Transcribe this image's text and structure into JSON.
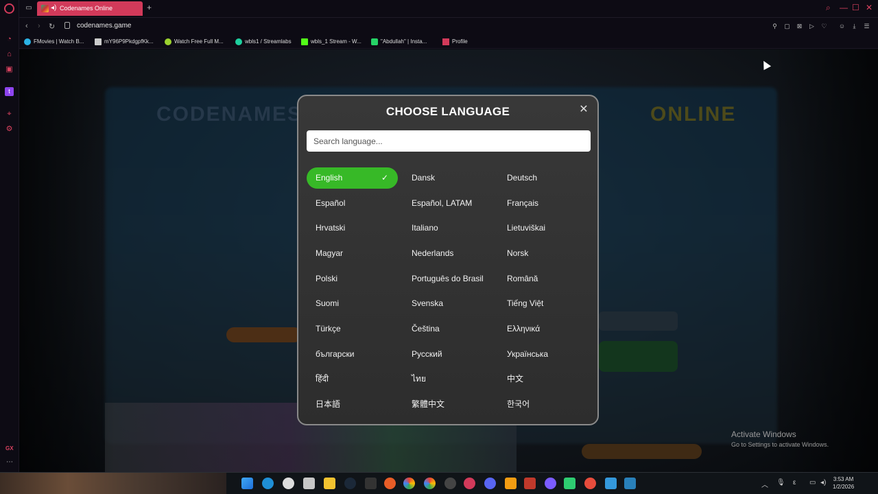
{
  "browser": {
    "tab_title": "Codenames Online",
    "url": "codenames.game",
    "bookmarks": [
      {
        "label": "FMovies | Watch B...",
        "color": "#2bb3e6"
      },
      {
        "label": "mY96P9PkdgpfKk...",
        "color": "#cccccc"
      },
      {
        "label": "Watch Free Full M...",
        "color": "#9bd12e"
      },
      {
        "label": "wbls1 / Streamlabs",
        "color": "#1ecf9e"
      },
      {
        "label": "wbls_1 Stream - W...",
        "color": "#53fc18"
      },
      {
        "label": "\"Abdullah\" | Insta...",
        "color": "#25d366"
      },
      {
        "label": "Profile",
        "color": "#d23a5a"
      }
    ]
  },
  "modal": {
    "title": "CHOOSE LANGUAGE",
    "search_placeholder": "Search language...",
    "selected": "English",
    "languages": [
      [
        "English",
        "Dansk",
        "Deutsch"
      ],
      [
        "Español",
        "Español, LATAM",
        "Français"
      ],
      [
        "Hrvatski",
        "Italiano",
        "Lietuviškai"
      ],
      [
        "Magyar",
        "Nederlands",
        "Norsk"
      ],
      [
        "Polski",
        "Português do Brasil",
        "Română"
      ],
      [
        "Suomi",
        "Svenska",
        "Tiếng Việt"
      ],
      [
        "Türkçe",
        "Čeština",
        "Ελληνικά"
      ],
      [
        "български",
        "Русский",
        "Українська"
      ],
      [
        "हिंदी",
        "ไทย",
        "中文"
      ],
      [
        "日本語",
        "繁體中文",
        "한국어"
      ]
    ]
  },
  "background": {
    "title_left": "CODENAMES",
    "title_right": "ONLINE"
  },
  "watermark": {
    "line1": "Activate Windows",
    "line2": "Go to Settings to activate Windows."
  },
  "taskbar": {
    "time": "3:53 AM",
    "date": "1/2/2026"
  },
  "colors": {
    "accent": "#d23a5a",
    "selected_language": "#37b927"
  }
}
